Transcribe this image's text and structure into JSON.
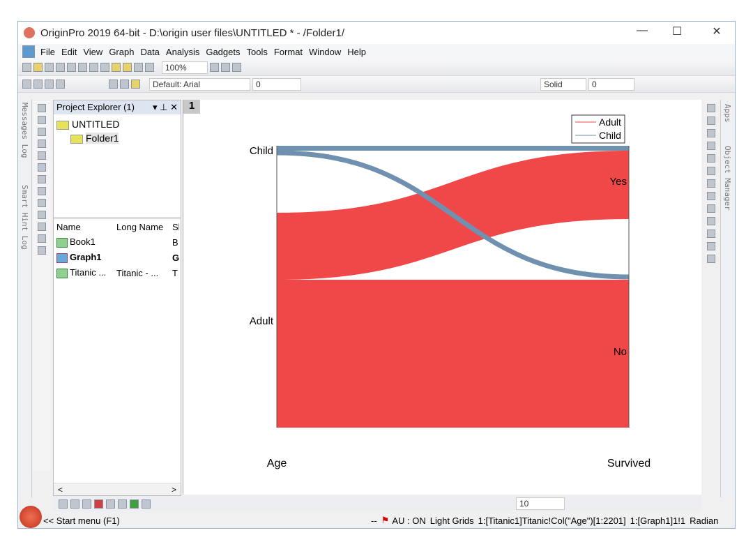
{
  "window": {
    "title": "OriginPro 2019 64-bit - D:\\origin user files\\UNTITLED * - /Folder1/",
    "minimize": "—",
    "maximize": "☐",
    "close": "✕"
  },
  "menu": [
    "File",
    "Edit",
    "View",
    "Graph",
    "Data",
    "Analysis",
    "Gadgets",
    "Tools",
    "Format",
    "Window",
    "Help"
  ],
  "toolbar": {
    "zoom": "100%",
    "font": "Default: Arial",
    "font_size": "0",
    "line_style": "Solid",
    "line_width": "0",
    "bottom_size": "10"
  },
  "side_tabs": {
    "left": [
      "Messages Log",
      "Smart Hint Log"
    ],
    "right": [
      "Apps",
      "Object Manager"
    ]
  },
  "project_explorer": {
    "title": "Project Explorer (1)",
    "tree": {
      "root": "UNTITLED",
      "folder": "Folder1"
    },
    "columns": [
      "Name",
      "Long Name",
      "Sl"
    ],
    "rows": [
      {
        "name": "Book1",
        "long": "",
        "s": "B"
      },
      {
        "name": "Graph1",
        "long": "",
        "s": "G"
      },
      {
        "name": "Titanic ...",
        "long": "Titanic - ...",
        "s": "T"
      }
    ]
  },
  "graph": {
    "layer": "1"
  },
  "chart_data": {
    "type": "sankey",
    "axes": [
      "Age",
      "Survived"
    ],
    "nodes_left": [
      "Child",
      "Adult"
    ],
    "nodes_right": [
      "Yes",
      "No"
    ],
    "legend": [
      "Adult",
      "Child"
    ],
    "legend_position": "top-right",
    "colors": {
      "Adult": "#f04848",
      "Child": "#7090b0"
    },
    "flows": [
      {
        "from": "Child",
        "to": "Yes",
        "series": "Child"
      },
      {
        "from": "Child",
        "to": "No",
        "series": "Child"
      },
      {
        "from": "Adult",
        "to": "Yes",
        "series": "Adult"
      },
      {
        "from": "Adult",
        "to": "No",
        "series": "Adult"
      }
    ]
  },
  "status": {
    "start": "<< Start menu (F1)",
    "dash": "--",
    "au": "AU : ON",
    "grids": "Light Grids",
    "col": "1:[Titanic1]Titanic!Col(\"Age\")[1:2201]",
    "graph": "1:[Graph1]1!1",
    "angle": "Radian"
  }
}
